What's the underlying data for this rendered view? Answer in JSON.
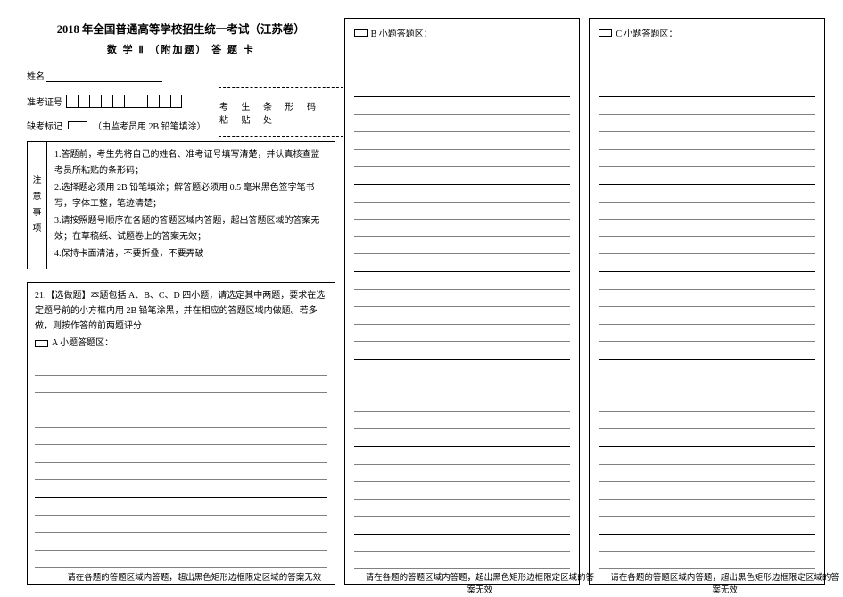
{
  "header": {
    "main_title": "2018 年全国普通高等学校招生统一考试（江苏卷）",
    "sub_title": "数 学 Ⅱ （附加题） 答 题 卡",
    "name_label": "姓名",
    "barcode_label": "考 生 条 形 码 粘 贴 处",
    "exam_no_label": "准考证号",
    "absent_label": "缺考标记",
    "absent_note": "（由监考员用 2B 铅笔填涂）"
  },
  "notice": {
    "side": [
      "注",
      "意",
      "事",
      "项"
    ],
    "items": [
      "1.答题前，考生先将自己的姓名、准考证号填写清楚，并认真核查监考员所粘贴的条形码；",
      "2.选择题必须用 2B 铅笔填涂；解答题必须用 0.5 毫米黑色签字笔书写，字体工整，笔迹清楚；",
      "3.请按照题号顺序在各题的答题区域内答题，超出答题区域的答案无效；在草稿纸、试题卷上的答案无效；",
      "4.保持卡面清洁，不要折叠，不要弄破"
    ]
  },
  "q21": {
    "text": "21.【选做题】本题包括 A、B、C、D 四小题，请选定其中两题，要求在选定题号前的小方框内用 2B 铅笔涂黑，并在相应的答题区域内做题。若多做，则按作答的前两题评分",
    "a_label": "A 小题答题区："
  },
  "colB": {
    "label": "B 小题答题区："
  },
  "colC": {
    "label": "C 小题答题区："
  },
  "footer": "请在各题的答题区域内答题，超出黑色矩形边框限定区域的答案无效"
}
